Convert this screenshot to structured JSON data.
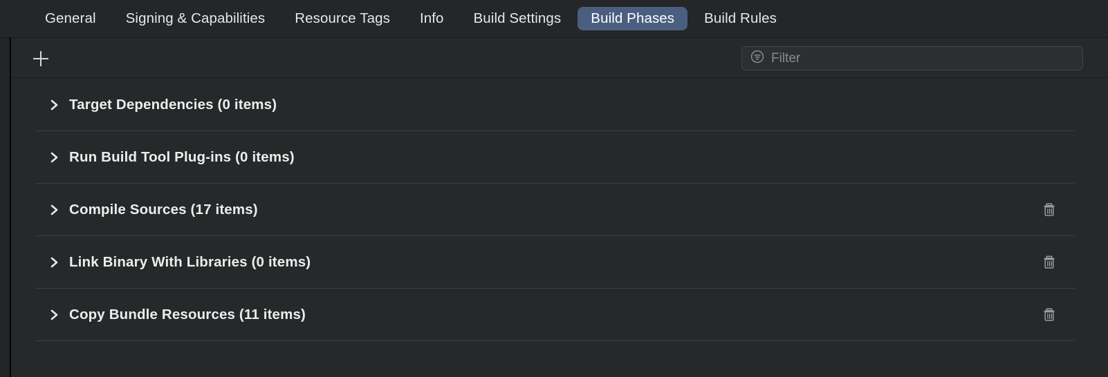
{
  "window": {
    "background_color": "#262829",
    "accent_color": "#4a5f80"
  },
  "tabs": [
    {
      "label": "General",
      "selected": false
    },
    {
      "label": "Signing & Capabilities",
      "selected": false
    },
    {
      "label": "Resource Tags",
      "selected": false
    },
    {
      "label": "Info",
      "selected": false
    },
    {
      "label": "Build Settings",
      "selected": false
    },
    {
      "label": "Build Phases",
      "selected": true
    },
    {
      "label": "Build Rules",
      "selected": false
    }
  ],
  "toolbar": {
    "add_phase_label": "+",
    "add_phase_icon": "plus-icon",
    "filter": {
      "icon": "filter-circle-icon",
      "placeholder": "Filter",
      "value": ""
    }
  },
  "phases": [
    {
      "name": "Target Dependencies",
      "count_label": "(0 items)",
      "title": "Target Dependencies (0 items)",
      "expanded": false,
      "disclosure_icon": "chevron-right-icon",
      "has_delete": false,
      "delete_icon": "trash-icon"
    },
    {
      "name": "Run Build Tool Plug-ins",
      "count_label": "(0 items)",
      "title": "Run Build Tool Plug-ins (0 items)",
      "expanded": false,
      "disclosure_icon": "chevron-right-icon",
      "has_delete": false,
      "delete_icon": "trash-icon"
    },
    {
      "name": "Compile Sources",
      "count_label": "(17 items)",
      "title": "Compile Sources (17 items)",
      "expanded": false,
      "disclosure_icon": "chevron-right-icon",
      "has_delete": true,
      "delete_icon": "trash-icon"
    },
    {
      "name": "Link Binary With Libraries",
      "count_label": "(0 items)",
      "title": "Link Binary With Libraries (0 items)",
      "expanded": false,
      "disclosure_icon": "chevron-right-icon",
      "has_delete": true,
      "delete_icon": "trash-icon"
    },
    {
      "name": "Copy Bundle Resources",
      "count_label": "(11 items)",
      "title": "Copy Bundle Resources (11 items)",
      "expanded": false,
      "disclosure_icon": "chevron-right-icon",
      "has_delete": true,
      "delete_icon": "trash-icon"
    }
  ]
}
